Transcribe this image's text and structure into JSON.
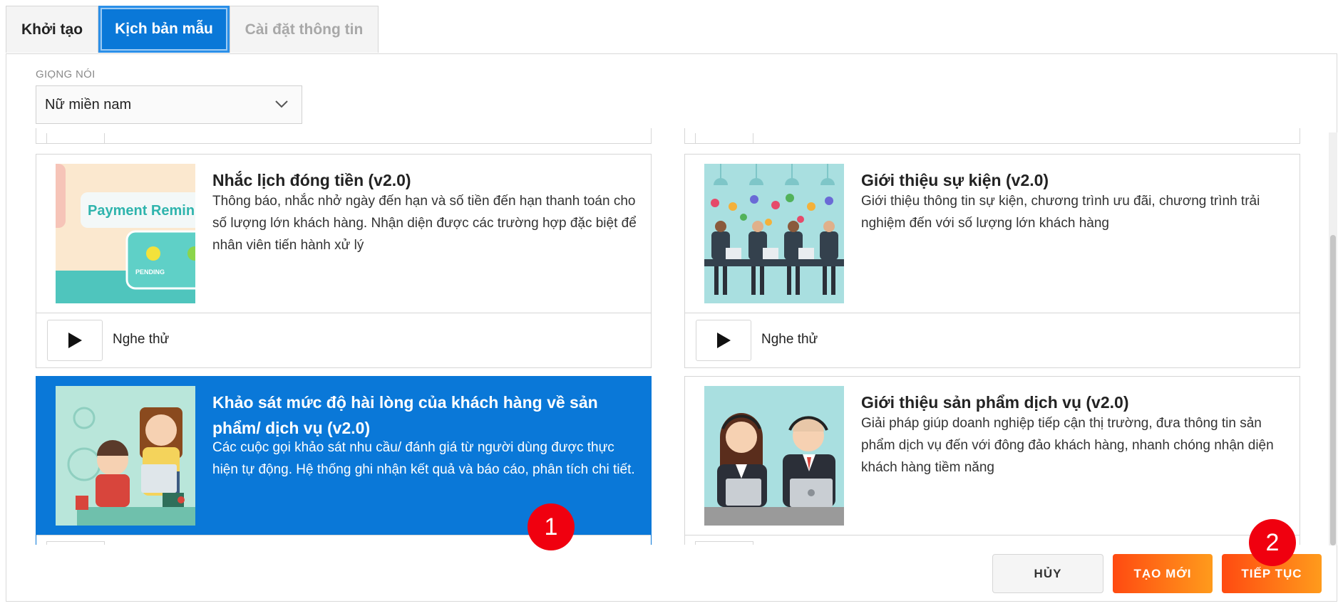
{
  "tabs": [
    {
      "label": "Khởi tạo",
      "active": false
    },
    {
      "label": "Kịch bản mẫu",
      "active": true
    },
    {
      "label": "Cài đặt thông tin",
      "active": false
    }
  ],
  "voice": {
    "label": "GIỌNG NÓI",
    "selected": "Nữ miền nam"
  },
  "templates": [
    {
      "title": "Nhắc lịch đóng tiền (v2.0)",
      "description": "Thông báo, nhắc nhở ngày đến hạn và số tiền đến hạn thanh toán cho số lượng lớn khách hàng. Nhận diện được các trường hợp đặc biệt để nhân viên tiến hành xử lý",
      "thumb_text": "Payment Remin",
      "thumb_sub": "PENDING",
      "play_label": "Nghe thử",
      "selected": false
    },
    {
      "title": "Giới thiệu sự kiện (v2.0)",
      "description": "Giới thiệu thông tin sự kiện, chương trình ưu đãi, chương trình trải nghiệm đến với số lượng lớn khách hàng",
      "play_label": "Nghe thử",
      "selected": false
    },
    {
      "title": "Khảo sát mức độ hài lòng của khách hàng về sản phẩm/ dịch vụ (v2.0)",
      "description": "Các cuộc gọi khảo sát nhu cầu/ đánh giá từ người dùng được thực hiện tự động. Hệ thống ghi nhận kết quả và báo cáo, phân tích chi tiết.",
      "selected": true
    },
    {
      "title": "Giới thiệu sản phẩm dịch vụ (v2.0)",
      "description": "Giải pháp giúp doanh nghiệp tiếp cận thị trường, đưa thông tin sản phẩm dịch vụ đến với đông đảo khách hàng, nhanh chóng nhận diện khách hàng tiềm năng",
      "selected": false
    }
  ],
  "actions": {
    "cancel": "HỦY",
    "create": "TẠO MỚI",
    "next": "TIẾP TỤC"
  },
  "markers": [
    "1",
    "2"
  ],
  "colors": {
    "primary": "#0a78d8",
    "accent_start": "#ff4a11",
    "accent_end": "#ff9b1c",
    "marker": "#f0000f"
  }
}
